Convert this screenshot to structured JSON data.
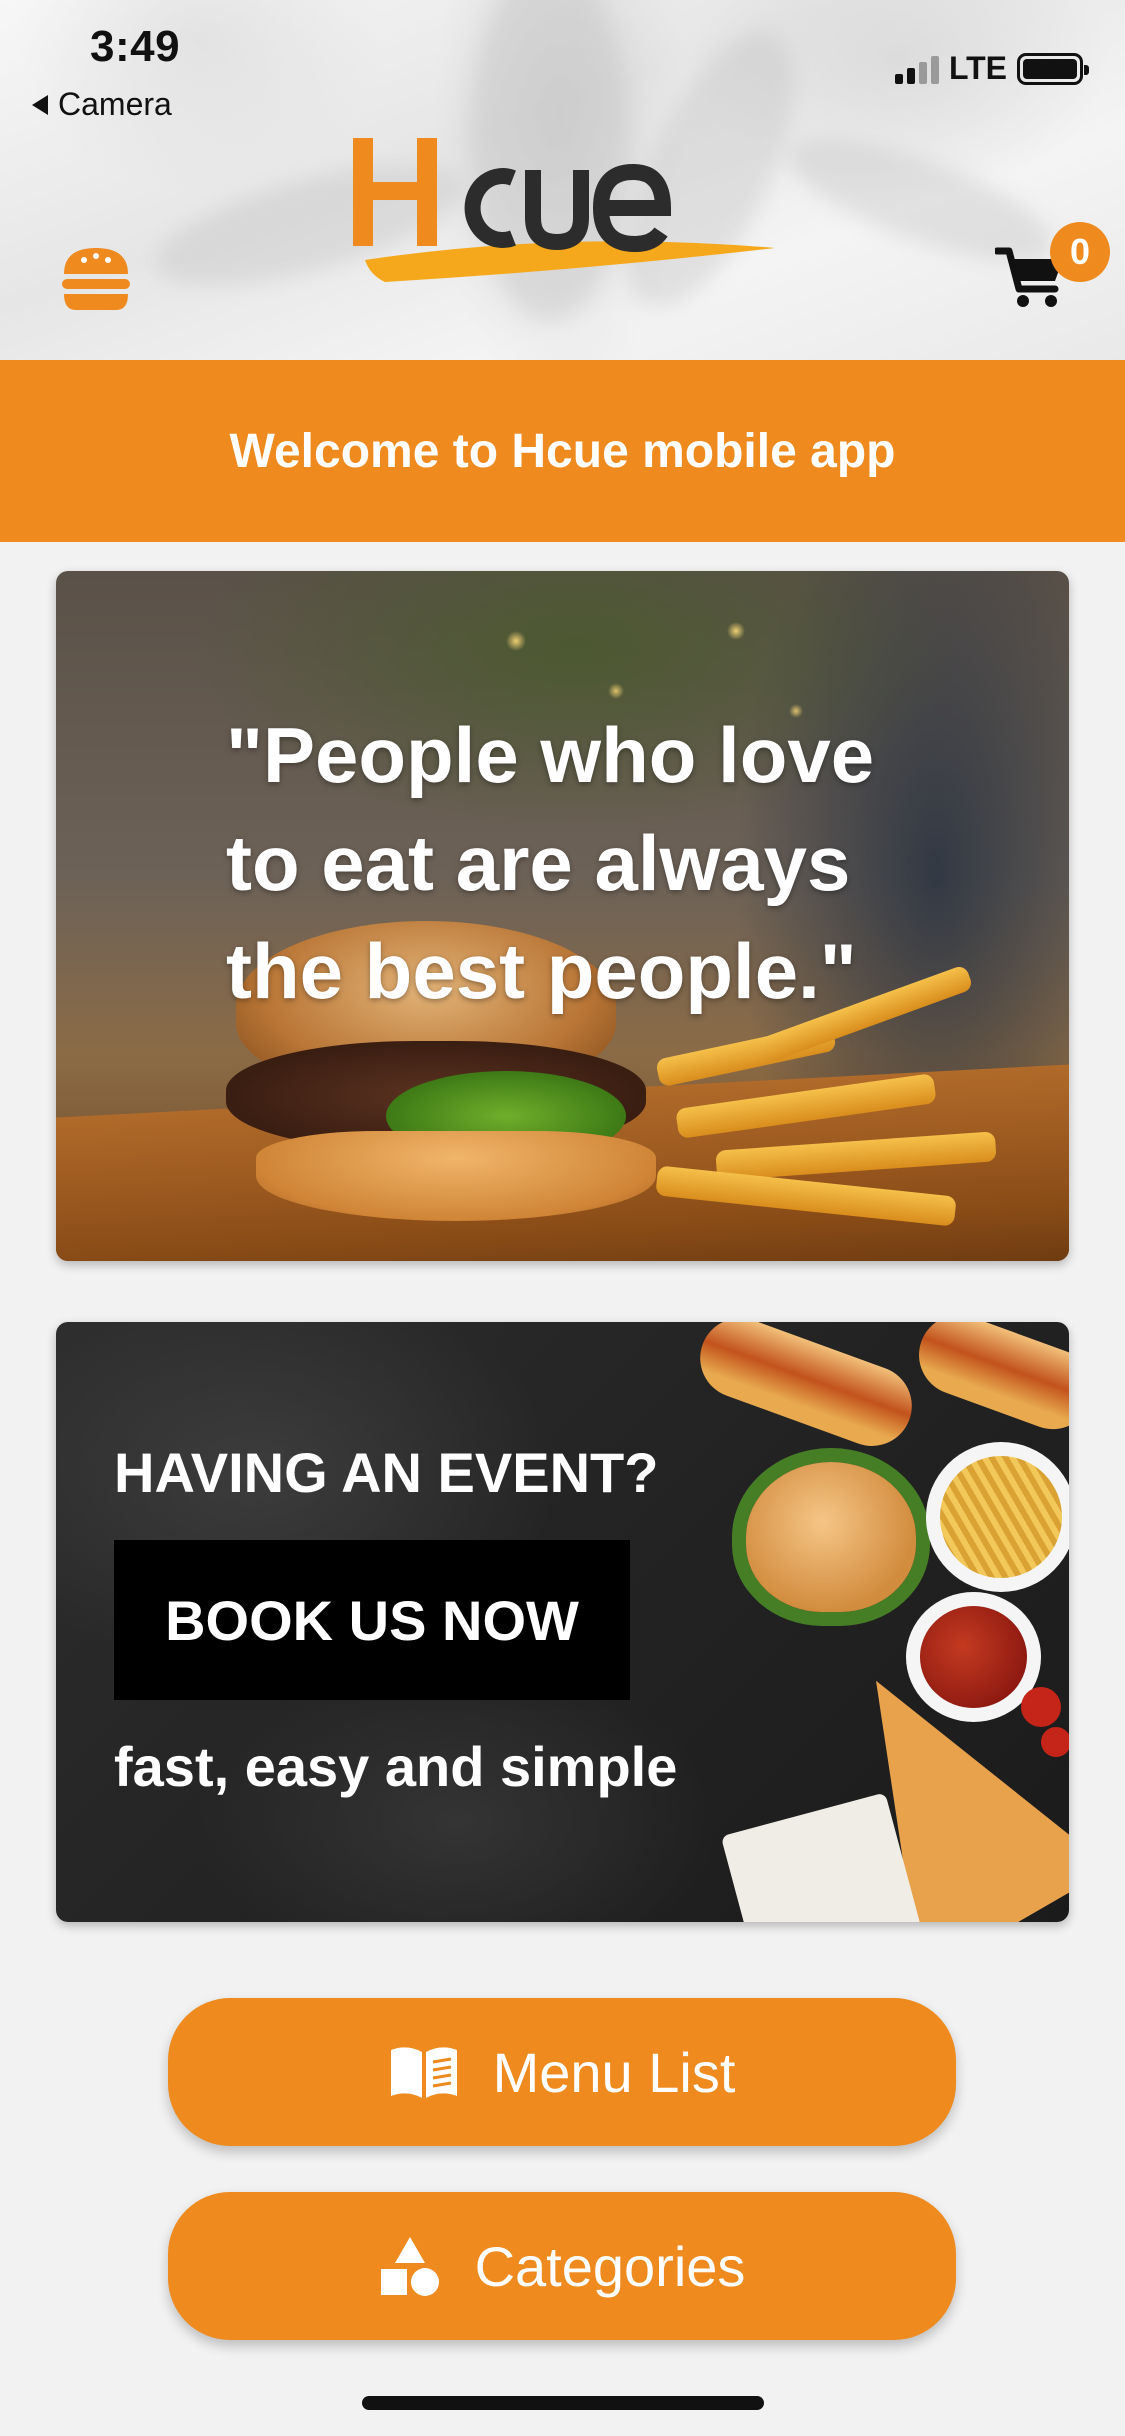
{
  "status_bar": {
    "time": "3:49",
    "back_label": "Camera",
    "network": "LTE"
  },
  "header": {
    "logo_text": "Hcue",
    "cart_count": "0"
  },
  "welcome": {
    "text": "Welcome to Hcue mobile app"
  },
  "quote_card": {
    "quote": "\"People who love to eat are always the best people.\""
  },
  "event_card": {
    "title": "HAVING AN EVENT?",
    "button_label": "BOOK US NOW",
    "subtitle": "fast, easy and simple"
  },
  "actions": [
    {
      "label": "Menu List",
      "icon": "book-open-icon"
    },
    {
      "label": "Categories",
      "icon": "shapes-icon"
    }
  ],
  "colors": {
    "accent": "#ee8a1e",
    "background": "#f2f2f2",
    "text_dark": "#111111"
  }
}
